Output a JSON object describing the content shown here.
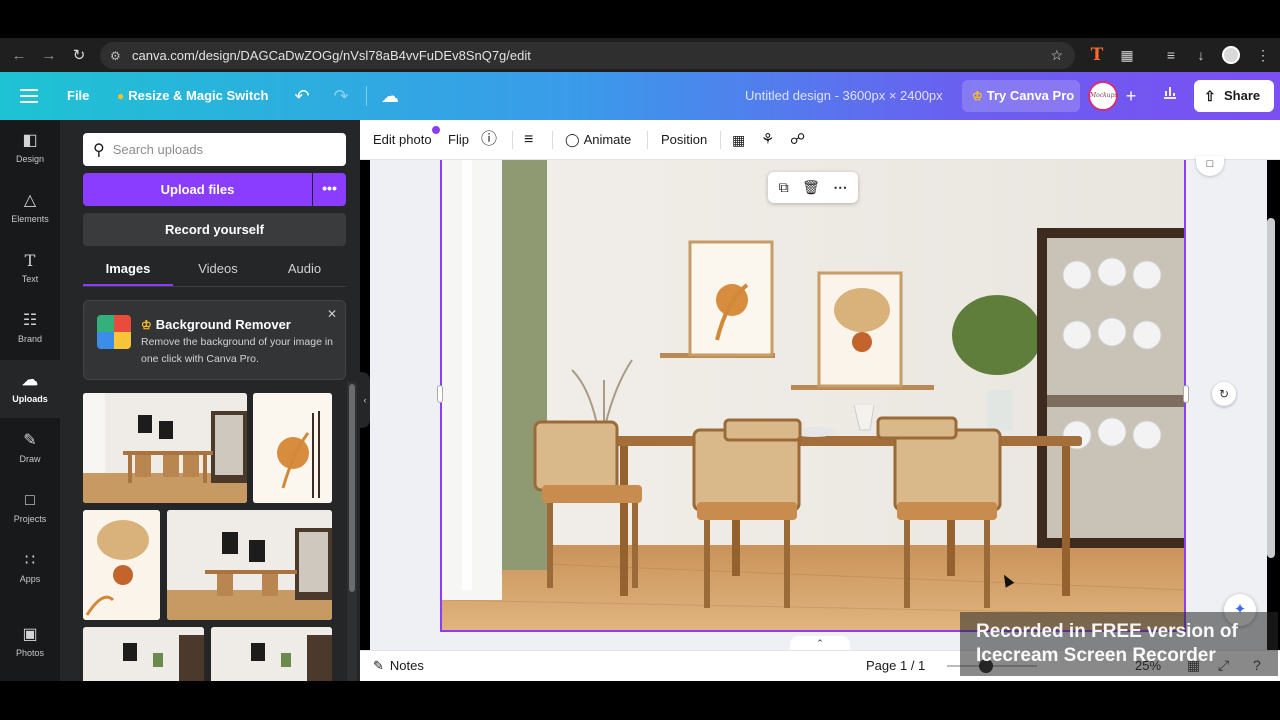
{
  "browser": {
    "url": "canva.com/design/DAGCaDwZOGg/nVsl78aB4vvFuDEv8SnQ7g/edit",
    "extension_letter": "T"
  },
  "header": {
    "file_label": "File",
    "resize_label": "Resize & Magic Switch",
    "doc_title": "Untitled design - 3600px × 2400px",
    "try_pro_label": "Try Canva Pro",
    "share_label": "Share",
    "brand_logo_text": "Mockups"
  },
  "rail": {
    "items": [
      {
        "label": "Design",
        "icon": "layout-icon"
      },
      {
        "label": "Elements",
        "icon": "shapes-icon"
      },
      {
        "label": "Text",
        "icon": "text-icon"
      },
      {
        "label": "Brand",
        "icon": "brand-icon"
      },
      {
        "label": "Uploads",
        "icon": "cloud-upload-icon"
      },
      {
        "label": "Draw",
        "icon": "pen-icon"
      },
      {
        "label": "Projects",
        "icon": "folder-icon"
      },
      {
        "label": "Apps",
        "icon": "grid-icon"
      },
      {
        "label": "Photos",
        "icon": "image-icon"
      }
    ],
    "active": "Uploads"
  },
  "panel": {
    "search_placeholder": "Search uploads",
    "upload_label": "Upload files",
    "record_label": "Record yourself",
    "tabs": [
      "Images",
      "Videos",
      "Audio"
    ],
    "active_tab": "Images",
    "promo": {
      "title": "Background Remover",
      "description": "Remove the background of your image in one click with Canva Pro."
    }
  },
  "toolbar": {
    "edit_photo": "Edit photo",
    "flip": "Flip",
    "animate": "Animate",
    "position": "Position"
  },
  "footer": {
    "notes": "Notes",
    "page": "Page 1 / 1",
    "zoom": "25%"
  },
  "watermark": {
    "line1": "Recorded in FREE version of",
    "line2": "Icecream  Screen  Recorder"
  },
  "colors": {
    "accent": "#8b3dff",
    "header_start": "#1ec3d3",
    "header_end": "#7b4ff2",
    "panel_bg": "#252627"
  }
}
